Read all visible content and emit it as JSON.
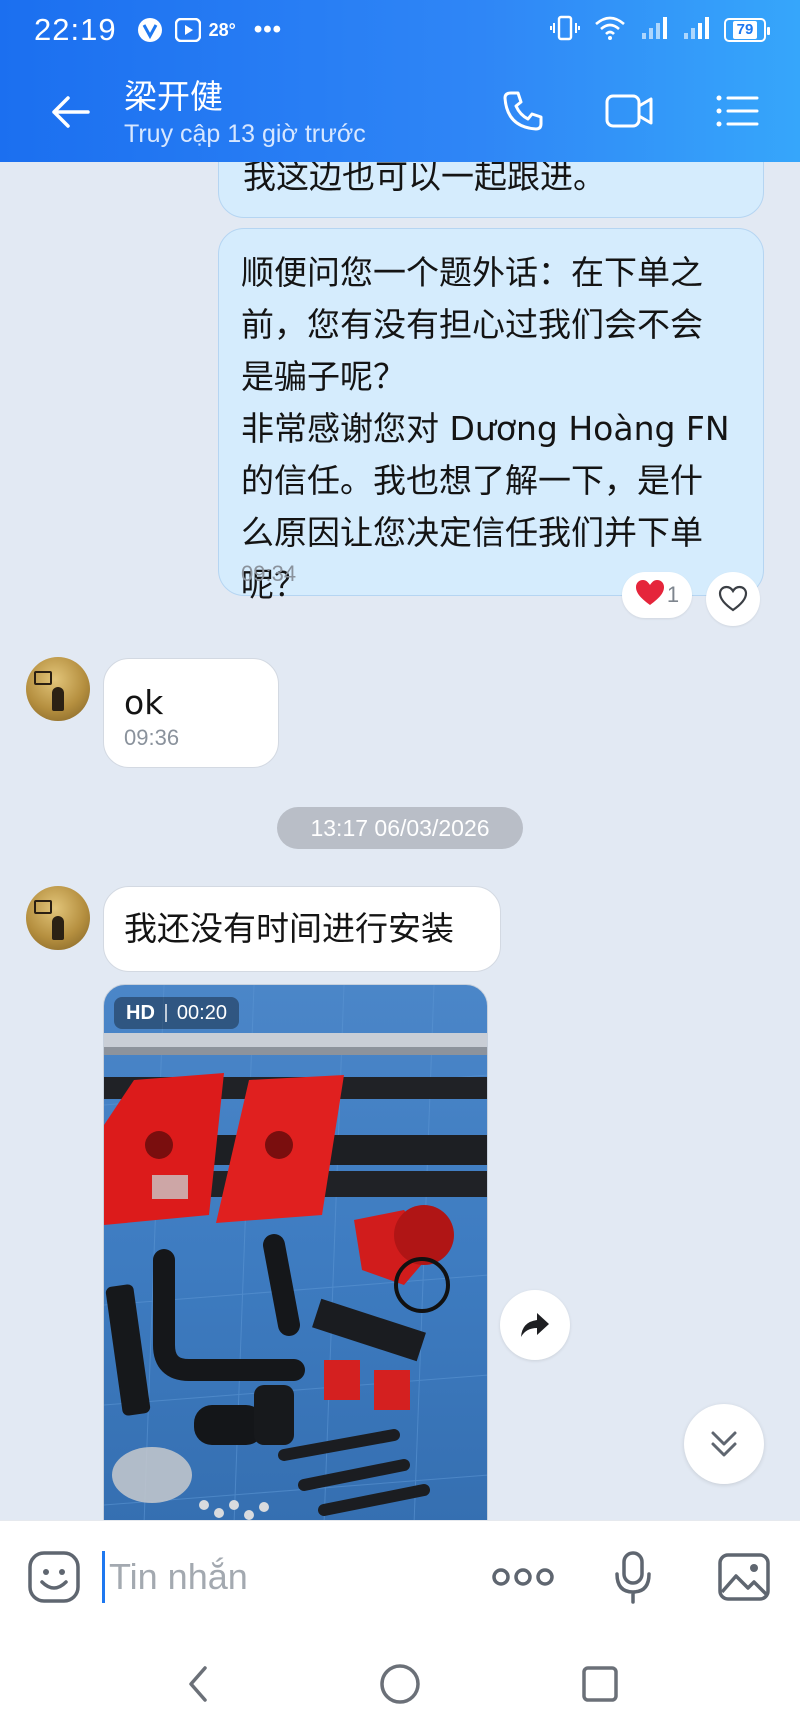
{
  "status_bar": {
    "time": "22:19",
    "temperature": "28°",
    "more": "•••",
    "battery": "79"
  },
  "header": {
    "contact_name": "梁开健",
    "last_seen": "Truy cập 13 giờ trước",
    "icons": [
      "back-arrow-icon",
      "phone-icon",
      "video-call-icon",
      "menu-icon"
    ]
  },
  "messages": {
    "partial_top": {
      "text": "我这边也可以一起跟进。"
    },
    "outgoing_1": {
      "text": "顺便问您一个题外话：在下单之\n前，您有没有担心过我们会不会\n是骗子呢？\n非常感谢您对 Dương Hoàng FN\n的信任。我也想了解一下，是什\n么原因让您决定信任我们并下单\n呢？",
      "time": "09:34",
      "reaction_count": "1"
    },
    "incoming_1": {
      "text": "ok",
      "time": "09:36"
    },
    "date_separator": "13:17 06/03/2026",
    "incoming_2": {
      "text": "我还没有时间进行安装"
    },
    "video": {
      "quality": "HD",
      "duration": "00:20"
    }
  },
  "input_bar": {
    "placeholder": "Tin nhắn",
    "more_label": "ooo"
  },
  "colors": {
    "header_start": "#1b6ff0",
    "header_end": "#36a6fb",
    "chat_bg": "#e2e9f3",
    "outgoing_bubble": "#d5ecfd",
    "incoming_bubble": "#ffffff",
    "accent": "#1e78f0"
  }
}
